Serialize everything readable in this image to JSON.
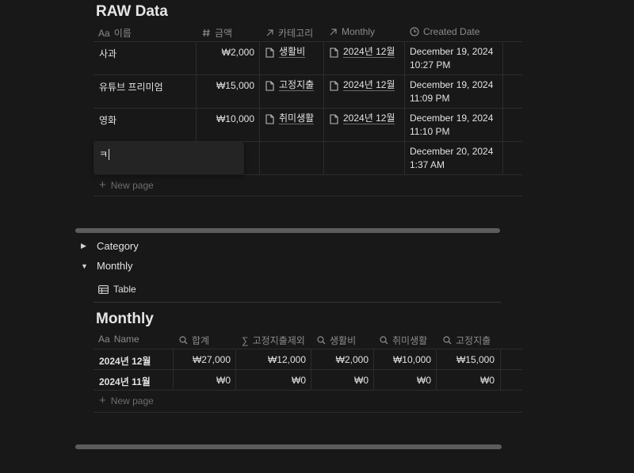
{
  "raw": {
    "title": "RAW Data",
    "columns": {
      "name": "이름",
      "amount": "금액",
      "category": "카테고리",
      "monthly": "Monthly",
      "created": "Created Date"
    },
    "col_prefix_name": "Aa",
    "rows": [
      {
        "name": "사과",
        "amount": "₩2,000",
        "category": "생활비",
        "monthly": "2024년 12월",
        "date1": "December 19, 2024",
        "date2": "10:27 PM"
      },
      {
        "name": "유튜브 프리미엄",
        "amount": "₩15,000",
        "category": "고정지출",
        "monthly": "2024년 12월",
        "date1": "December 19, 2024",
        "date2": "11:09 PM"
      },
      {
        "name": "영화",
        "amount": "₩10,000",
        "category": "취미생활",
        "monthly": "2024년 12월",
        "date1": "December 19, 2024",
        "date2": "11:10 PM"
      },
      {
        "name": "ㅋ",
        "amount": "",
        "category": "",
        "monthly": "",
        "date1": "December 20, 2024",
        "date2": "1:37 AM"
      }
    ],
    "new_page": "New page"
  },
  "toggles": [
    {
      "label": "Category",
      "state": "collapsed"
    },
    {
      "label": "Monthly",
      "state": "expanded"
    }
  ],
  "view_tab": "Table",
  "monthly": {
    "title": "Monthly",
    "columns": {
      "name": "Name",
      "total": "합계",
      "excl_fixed": "고정지출제외",
      "living": "생활비",
      "hobby": "취미생활",
      "fixed": "고정지출"
    },
    "col_prefix_name": "Aa",
    "rows": [
      {
        "name": "2024년 12월",
        "total": "₩27,000",
        "excl_fixed": "₩12,000",
        "living": "₩2,000",
        "hobby": "₩10,000",
        "fixed": "₩15,000"
      },
      {
        "name": "2024년 11월",
        "total": "₩0",
        "excl_fixed": "₩0",
        "living": "₩0",
        "hobby": "₩0",
        "fixed": "₩0"
      }
    ],
    "new_page": "New page"
  },
  "colors": {
    "background": "#191819",
    "text": "#e2e2e2",
    "muted": "#8b8b8b",
    "divider": "#2c2c2c"
  }
}
